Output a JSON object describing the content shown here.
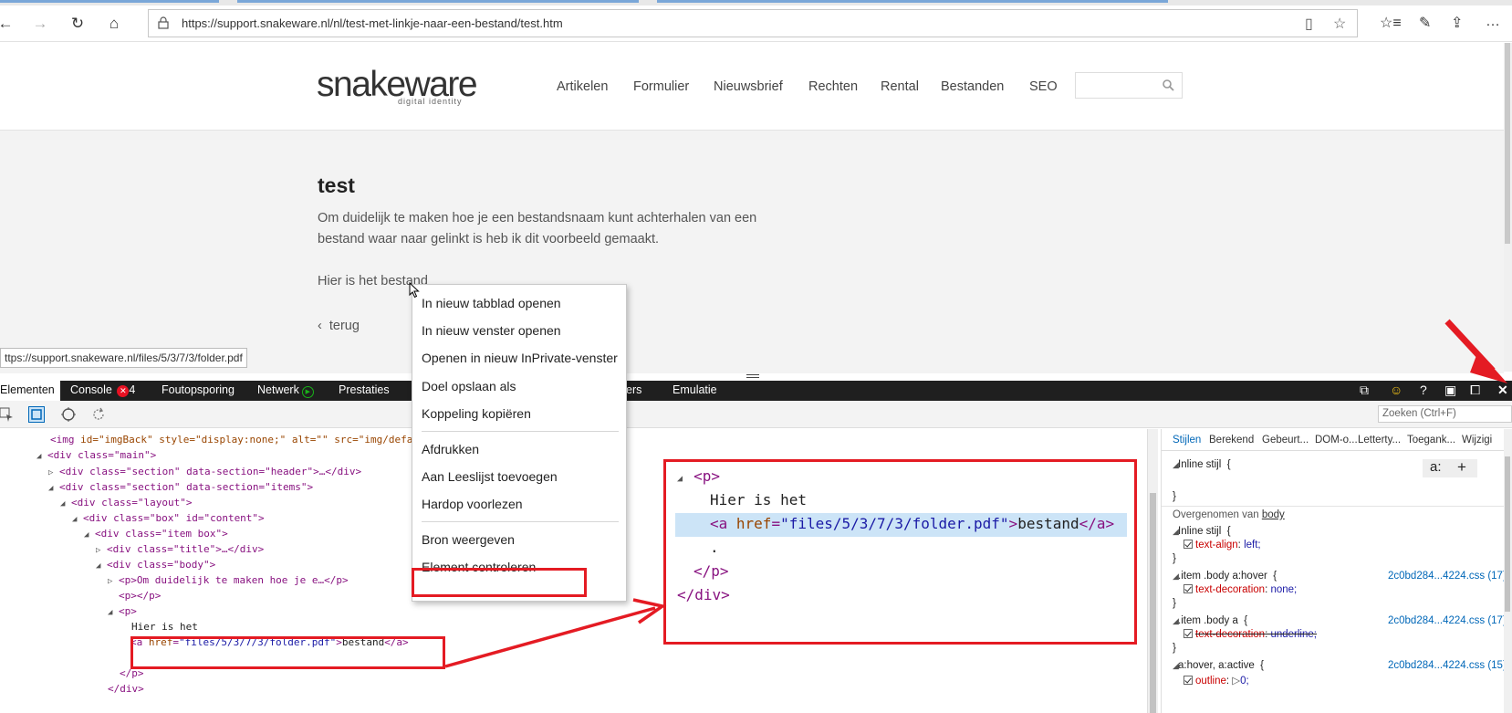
{
  "browser": {
    "url": "https://support.snakeware.nl/nl/test-met-linkje-naar-een-bestand/test.htm",
    "icons": [
      "back-icon",
      "forward-icon",
      "refresh-icon",
      "home-icon",
      "lock-icon",
      "reading-view-icon",
      "favorite-star-icon",
      "favorites-hub-icon",
      "pen-icon",
      "share-icon",
      "more-icon"
    ]
  },
  "site": {
    "logo": "snakeware",
    "logo_sub": "digital identity",
    "nav": [
      "Artikelen",
      "Formulier",
      "Nieuwsbrief",
      "Rechten",
      "Rental",
      "Bestanden",
      "SEO"
    ],
    "title": "test",
    "paragraph": "Om duidelijk te maken hoe je een bestandsnaam kunt achterhalen van een bestand waar naar gelinkt is heb ik dit voorbeeld gemaakt.",
    "file_line": "Hier is het bestand",
    "back_link": "terug"
  },
  "status_link": "ttps://support.snakeware.nl/files/5/3/7/3/folder.pdf",
  "context_menu": {
    "items": [
      "In nieuw tabblad openen",
      "In nieuw venster openen",
      "Openen in nieuw InPrivate-venster",
      "Doel opslaan als",
      "Koppeling kopiëren",
      "Afdrukken",
      "Aan Leeslijst toevoegen",
      "Hardop voorlezen",
      "Bron weergeven",
      "Element controleren"
    ],
    "highlighted": "Element controleren"
  },
  "devtools": {
    "tabs": {
      "elements": "Elementen",
      "console": "Console",
      "console_errors": "4",
      "debugger": "Foutopsporing",
      "network": "Netwerk",
      "performance": "Prestaties",
      "hidden_partial": "ers",
      "emulation": "Emulatie"
    },
    "find_placeholder": "Zoeken (Ctrl+F)",
    "dom": {
      "l1": {
        "tag": "img",
        "attrs": " id=\"imgBack\" style=\"display:none;\" alt=\"\" src=\"img/defa"
      },
      "l2": "<div class=\"main\">",
      "l3": "<div class=\"section\" data-section=\"header\">…</div>",
      "l4": "<div class=\"section\" data-section=\"items\">",
      "l5": "<div class=\"layout\">",
      "l6": "<div class=\"box\" id=\"content\">",
      "l7": "<div class=\"item box\">",
      "l8": "<div class=\"title\">…</div>",
      "l9": "<div class=\"body\">",
      "l10": "<p>Om duidelijk te maken hoe je e…</p>",
      "l11": "<p></p>",
      "l12": "<p>",
      "l13": "Hier is het",
      "l14_href": "files/5/3/7/3/folder.pdf",
      "l14_text": "bestand",
      "l15": "</p>",
      "l16": "</div>"
    },
    "styles": {
      "tabs": [
        "Stijlen",
        "Berekend",
        "Gebeurt...",
        "DOM-o...",
        "Letterty...",
        "Toegank...",
        "Wijzigi"
      ],
      "inline_style": "Inline stijl",
      "inherited_from": "Overgenomen van",
      "inherited_el": "body",
      "rules": [
        {
          "selector": "Inline stijl",
          "prop": "text-align",
          "value": "left;"
        },
        {
          "selector": ".item .body a:hover",
          "prop": "text-decoration",
          "value": "none;",
          "source": "2c0bd284...4224.css (17)"
        },
        {
          "selector": ".item .body a",
          "prop": "text-decoration",
          "value": "underline;",
          "source": "2c0bd284...4224.css (17)"
        },
        {
          "selector": "a:hover, a:active",
          "prop": "outline",
          "value": "0;",
          "source": "2c0bd284...4224.css (15)"
        }
      ],
      "toolbar_a": "a:",
      "toolbar_plus": "+"
    }
  },
  "zoom_callout": {
    "p_open": "<p>",
    "text": "Hier is het",
    "a_href": "files/5/3/7/3/folder.pdf",
    "a_text": "bestand",
    "dot": ".",
    "p_close": "</p>",
    "div_close": "</div>"
  },
  "colors": {
    "annotation_red": "#e41b23",
    "link_blue": "#0067b8",
    "selection": "#cce4f7"
  }
}
